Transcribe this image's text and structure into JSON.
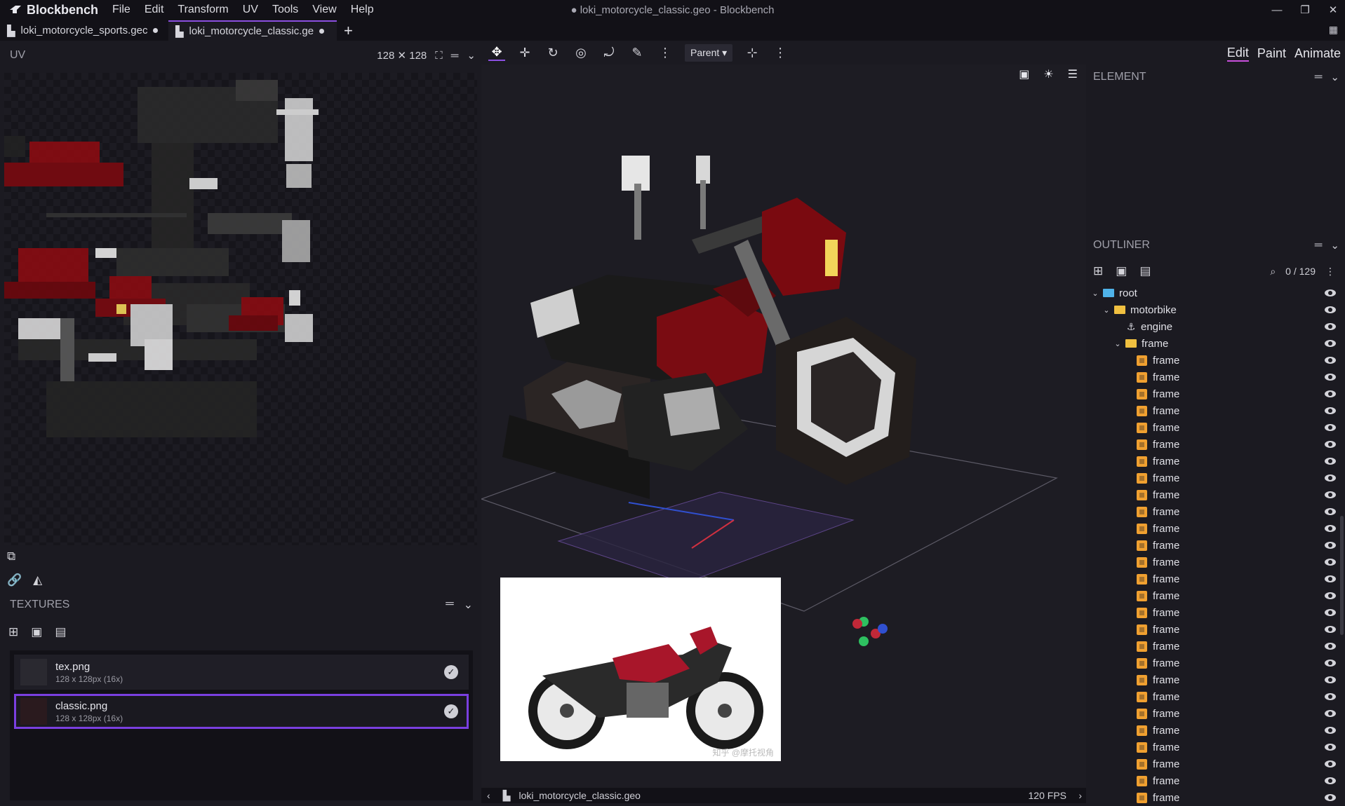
{
  "app": {
    "name": "Blockbench",
    "window_title": "● loki_motorcycle_classic.geo - Blockbench",
    "menu": [
      "File",
      "Edit",
      "Transform",
      "UV",
      "Tools",
      "View",
      "Help"
    ]
  },
  "project_tabs": [
    {
      "label": "loki_motorcycle_sports.gec",
      "active": false
    },
    {
      "label": "loki_motorcycle_classic.ge",
      "active": true
    }
  ],
  "uv_panel": {
    "title": "UV",
    "size_label": "128 ✕ 128"
  },
  "textures_panel": {
    "title": "TEXTURES",
    "items": [
      {
        "name": "tex.png",
        "info": "128 x 128px (16x)",
        "selected": false
      },
      {
        "name": "classic.png",
        "info": "128 x 128px (16x)",
        "selected": true
      }
    ]
  },
  "toolbar": {
    "pivot_mode": "Parent"
  },
  "modes": [
    "Edit",
    "Paint",
    "Animate"
  ],
  "active_mode": "Edit",
  "element_panel": {
    "title": "ELEMENT"
  },
  "outliner": {
    "title": "OUTLINER",
    "count": "0 / 129",
    "tree": [
      {
        "label": "root",
        "type": "root",
        "depth": 0
      },
      {
        "label": "motorbike",
        "type": "folder",
        "depth": 1
      },
      {
        "label": "engine",
        "type": "locator",
        "depth": 2
      },
      {
        "label": "frame",
        "type": "folder",
        "depth": 2
      },
      {
        "label": "frame",
        "type": "cube",
        "depth": 3
      },
      {
        "label": "frame",
        "type": "cube",
        "depth": 3
      },
      {
        "label": "frame",
        "type": "cube",
        "depth": 3
      },
      {
        "label": "frame",
        "type": "cube",
        "depth": 3
      },
      {
        "label": "frame",
        "type": "cube",
        "depth": 3
      },
      {
        "label": "frame",
        "type": "cube",
        "depth": 3
      },
      {
        "label": "frame",
        "type": "cube",
        "depth": 3
      },
      {
        "label": "frame",
        "type": "cube",
        "depth": 3
      },
      {
        "label": "frame",
        "type": "cube",
        "depth": 3
      },
      {
        "label": "frame",
        "type": "cube",
        "depth": 3
      },
      {
        "label": "frame",
        "type": "cube",
        "depth": 3
      },
      {
        "label": "frame",
        "type": "cube",
        "depth": 3
      },
      {
        "label": "frame",
        "type": "cube",
        "depth": 3
      },
      {
        "label": "frame",
        "type": "cube",
        "depth": 3
      },
      {
        "label": "frame",
        "type": "cube",
        "depth": 3
      },
      {
        "label": "frame",
        "type": "cube",
        "depth": 3
      },
      {
        "label": "frame",
        "type": "cube",
        "depth": 3
      },
      {
        "label": "frame",
        "type": "cube",
        "depth": 3
      },
      {
        "label": "frame",
        "type": "cube",
        "depth": 3
      },
      {
        "label": "frame",
        "type": "cube",
        "depth": 3
      },
      {
        "label": "frame",
        "type": "cube",
        "depth": 3
      },
      {
        "label": "frame",
        "type": "cube",
        "depth": 3
      },
      {
        "label": "frame",
        "type": "cube",
        "depth": 3
      },
      {
        "label": "frame",
        "type": "cube",
        "depth": 3
      },
      {
        "label": "frame",
        "type": "cube",
        "depth": 3
      },
      {
        "label": "frame",
        "type": "cube",
        "depth": 3
      },
      {
        "label": "frame",
        "type": "cube",
        "depth": 3
      }
    ]
  },
  "status": {
    "file": "loki_motorcycle_classic.geo",
    "fps": "120 FPS"
  },
  "reference_image": {
    "watermark": "知乎 @摩托视角"
  },
  "colors": {
    "accent": "#8b4fe0",
    "mode_underline": "#c84fdc",
    "bike_red": "#8a0c12",
    "folder": "#f0c040",
    "root_folder": "#4fb2e8",
    "cube": "#f0a030"
  }
}
